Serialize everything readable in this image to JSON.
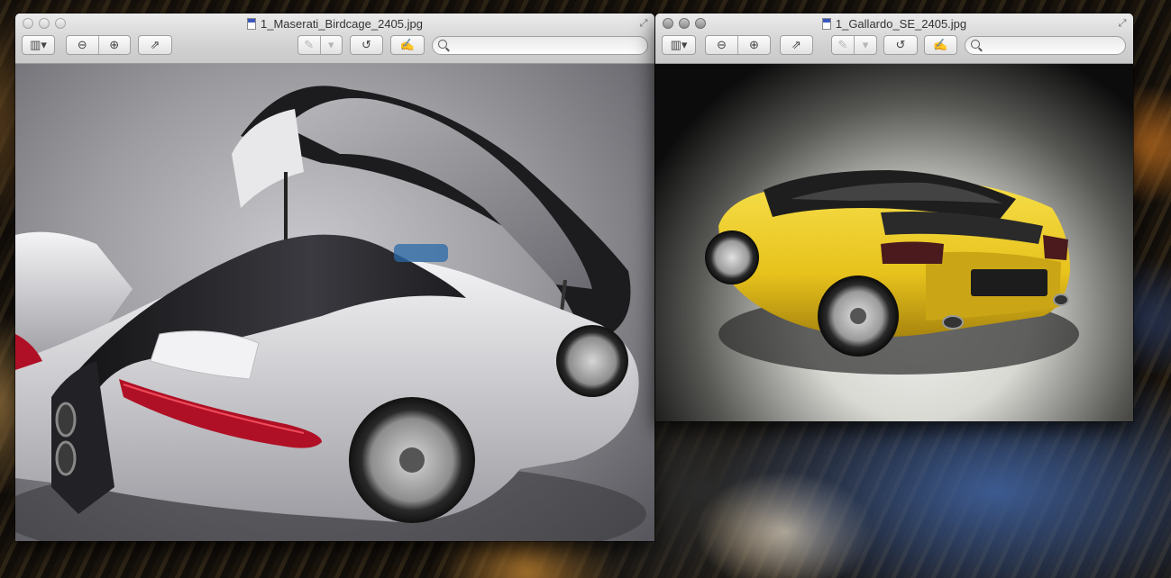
{
  "colors": {
    "titlebar_top": "#ebebeb",
    "titlebar_bottom": "#c9c9c9",
    "maserati_body": "#e4e4e6",
    "maserati_tail": "#b01025",
    "gallardo_body": "#e7c21c"
  },
  "windows": [
    {
      "title": "1_Maserati_Birdcage_2405.jpg",
      "toolbar": {
        "sidebar_icon": "sidebar-icon",
        "zoom_out_icon": "zoom-out-icon",
        "zoom_in_icon": "zoom-in-icon",
        "share_icon": "share-icon",
        "annotate_icon": "pen-icon",
        "rotate_icon": "rotate-icon",
        "edit_icon": "edit-icon",
        "search_placeholder": ""
      },
      "image": "Maserati Birdcage concept car, white with open canopy, rear view"
    },
    {
      "title": "1_Gallardo_SE_2405.jpg",
      "toolbar": {
        "sidebar_icon": "sidebar-icon",
        "zoom_out_icon": "zoom-out-icon",
        "zoom_in_icon": "zoom-in-icon",
        "share_icon": "share-icon",
        "annotate_icon": "pen-icon",
        "rotate_icon": "rotate-icon",
        "edit_icon": "edit-icon",
        "search_placeholder": ""
      },
      "image": "Yellow Lamborghini Gallardo SE, rear three-quarter view"
    }
  ]
}
